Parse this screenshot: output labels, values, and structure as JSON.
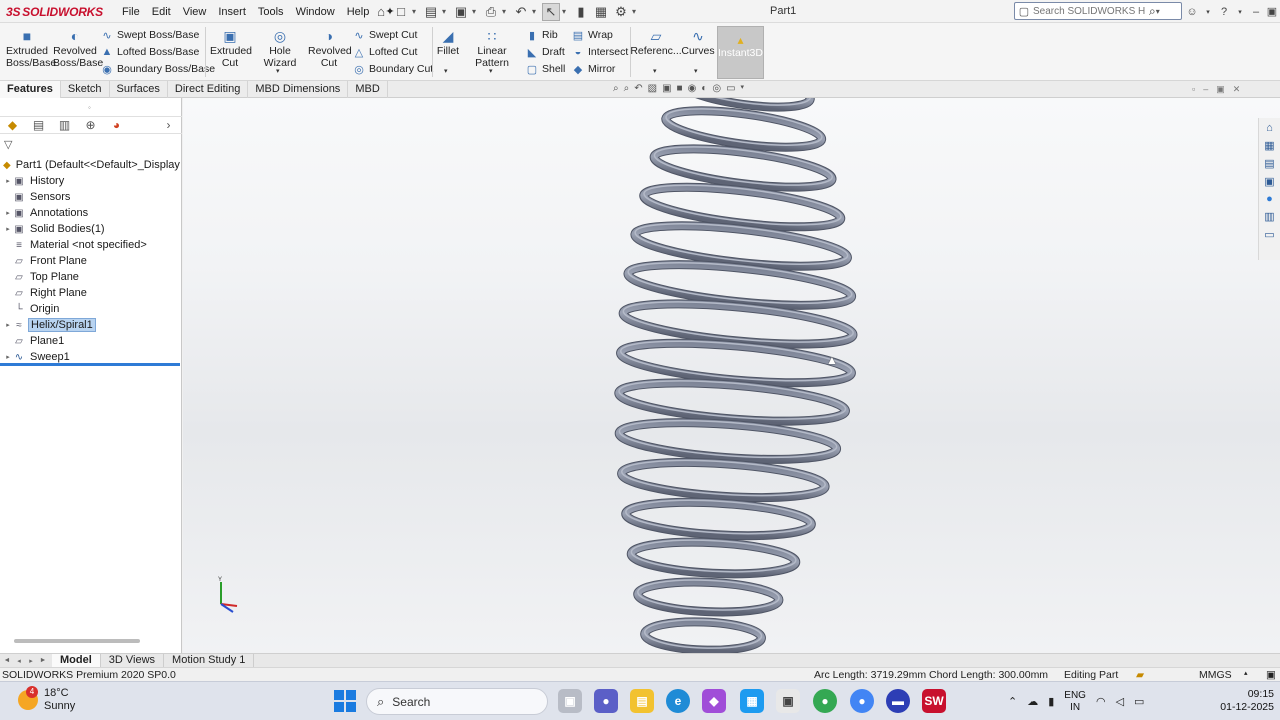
{
  "app": {
    "logo_ds": "3S",
    "logo_name": "SOLIDWORKS",
    "document_title": "Part1",
    "menus": [
      "File",
      "Edit",
      "View",
      "Insert",
      "Tools",
      "Window",
      "Help"
    ]
  },
  "search": {
    "placeholder": "Search SOLIDWORKS Help"
  },
  "command_manager": {
    "extruded_boss": "Extruded Boss/Base",
    "revolved_boss": "Revolved Boss/Base",
    "swept_boss": "Swept Boss/Base",
    "lofted_boss": "Lofted Boss/Base",
    "boundary_boss": "Boundary Boss/Base",
    "extruded_cut": "Extruded Cut",
    "hole_wizard": "Hole Wizard",
    "revolved_cut": "Revolved Cut",
    "swept_cut": "Swept Cut",
    "lofted_cut": "Lofted Cut",
    "boundary_cut": "Boundary Cut",
    "fillet": "Fillet",
    "linear_pattern": "Linear Pattern",
    "rib": "Rib",
    "draft": "Draft",
    "shell": "Shell",
    "wrap": "Wrap",
    "intersect": "Intersect",
    "mirror": "Mirror",
    "reference": "Referenc...",
    "curves": "Curves",
    "instant3d": "Instant3D"
  },
  "tabs": [
    "Features",
    "Sketch",
    "Surfaces",
    "Direct Editing",
    "MBD Dimensions",
    "MBD"
  ],
  "feature_tree": {
    "root": "Part1  (Default<<Default>_Display S",
    "items": [
      {
        "label": "History",
        "expandable": true,
        "icon": "history-icon"
      },
      {
        "label": "Sensors",
        "expandable": false,
        "icon": "sensors-icon"
      },
      {
        "label": "Annotations",
        "expandable": true,
        "icon": "annotations-icon"
      },
      {
        "label": "Solid Bodies(1)",
        "expandable": true,
        "icon": "solid-bodies-icon"
      },
      {
        "label": "Material <not specified>",
        "expandable": false,
        "icon": "material-icon"
      },
      {
        "label": "Front Plane",
        "expandable": false,
        "icon": "plane-icon"
      },
      {
        "label": "Top Plane",
        "expandable": false,
        "icon": "plane-icon"
      },
      {
        "label": "Right Plane",
        "expandable": false,
        "icon": "plane-icon"
      },
      {
        "label": "Origin",
        "expandable": false,
        "icon": "origin-icon"
      },
      {
        "label": "Helix/Spiral1",
        "expandable": true,
        "icon": "helix-icon",
        "selected": true
      },
      {
        "label": "Plane1",
        "expandable": false,
        "icon": "plane-icon"
      },
      {
        "label": "Sweep1",
        "expandable": true,
        "icon": "sweep-icon"
      }
    ]
  },
  "bottom_tabs": [
    "Model",
    "3D Views",
    "Motion Study 1"
  ],
  "status": {
    "version": "SOLIDWORKS Premium 2020 SP0.0",
    "measure": "Arc Length: 3719.29mm Chord Length: 300.00mm",
    "mode": "Editing Part",
    "units": "MMGS"
  },
  "taskbar": {
    "weather_temp": "18°C",
    "weather_desc": "Sunny",
    "weather_badge": "4",
    "search_text": "Search",
    "lang_top": "ENG",
    "lang_bottom": "IN",
    "time": "09:15",
    "date": "01-12-2025"
  }
}
